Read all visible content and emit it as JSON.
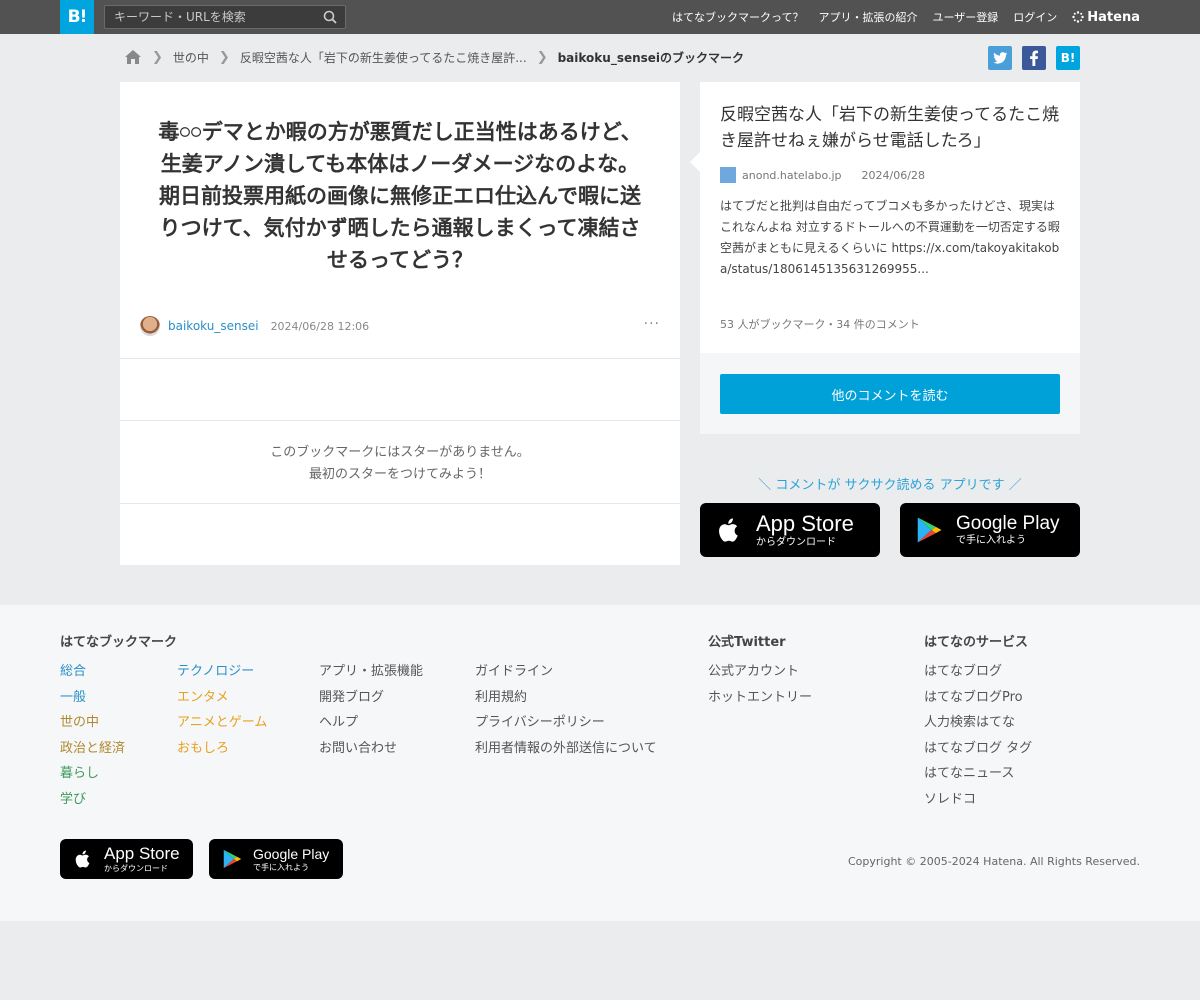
{
  "header": {
    "logo": "B!",
    "search_placeholder": "キーワード・URLを検索",
    "nav": [
      "はてなブックマークって？",
      "アプリ・拡張の紹介",
      "ユーザー登録",
      "ログイン"
    ],
    "brand": "Hatena"
  },
  "breadcrumb": {
    "items": [
      "世の中",
      "反暇空茜な人「岩下の新生姜使ってるたこ焼き屋許...",
      "baikoku_senseiのブックマーク"
    ]
  },
  "share": {
    "hatena_label": "B!"
  },
  "bookmark": {
    "comment": "毒𓏸𓏸デマとか暇の方が悪質だし正当性はあるけど、生姜アノン潰しても本体はノーダメージなのよな。期日前投票用紙の画像に無修正エロ仕込んで暇に送りつけて、気付かず晒したら通報しまくって凍結させるってどう？",
    "username": "baikoku_sensei",
    "timestamp": "2024/06/28 12:06",
    "more": "···",
    "no_star_line1": "このブックマークにはスターがありません。",
    "no_star_line2": "最初のスターをつけてみよう！"
  },
  "entry": {
    "title": "反暇空茜な人「岩下の新生姜使ってるたこ焼き屋許せねぇ嫌がらせ電話したろ」",
    "domain": "anond.hatelabo.jp",
    "date": "2024/06/28",
    "description": "はてブだと批判は自由だってブコメも多かったけどさ、現実はこれなんよね 対立するドトールへの不買運動を一切否定する暇空茜がまともに見えるくらいに https://x.com/takoyakitakoba/status/1806145135631269955...",
    "count": "53 人がブックマーク・34 件のコメント",
    "read_button": "他のコメントを読む"
  },
  "app_promo": {
    "text": "＼ コメントが サクサク読める アプリです ／",
    "appstore_main": "App Store",
    "appstore_sub": "からダウンロード",
    "googleplay_main": "Google Play",
    "googleplay_sub": "で手に入れよう"
  },
  "footer": {
    "col1_title": "はてなブックマーク",
    "categories_a": [
      "総合",
      "一般",
      "世の中",
      "政治と経済",
      "暮らし",
      "学び"
    ],
    "categories_b": [
      "テクノロジー",
      "エンタメ",
      "アニメとゲーム",
      "おもしろ"
    ],
    "links_c": [
      "アプリ・拡張機能",
      "開発ブログ",
      "ヘルプ",
      "お問い合わせ"
    ],
    "links_d": [
      "ガイドライン",
      "利用規約",
      "プライバシーポリシー",
      "利用者情報の外部送信について"
    ],
    "twitter_title": "公式Twitter",
    "twitter_links": [
      "公式アカウント",
      "ホットエントリー"
    ],
    "services_title": "はてなのサービス",
    "services": [
      "はてなブログ",
      "はてなブログPro",
      "人力検索はてな",
      "はてなブログ タグ",
      "はてなニュース",
      "ソレドコ"
    ],
    "copyright": "Copyright © 2005-2024 Hatena. All Rights Reserved."
  },
  "colors": {
    "accent": "#00a4de",
    "topbar": "#525252",
    "category_a": [
      "#2a8fc7",
      "#2a8fc7",
      "#b0892f",
      "#b0892f",
      "#3a9a5a",
      "#3a9a5a"
    ],
    "category_b": [
      "#2a8fc7",
      "#e8a020",
      "#e8a020",
      "#e8a020"
    ]
  }
}
